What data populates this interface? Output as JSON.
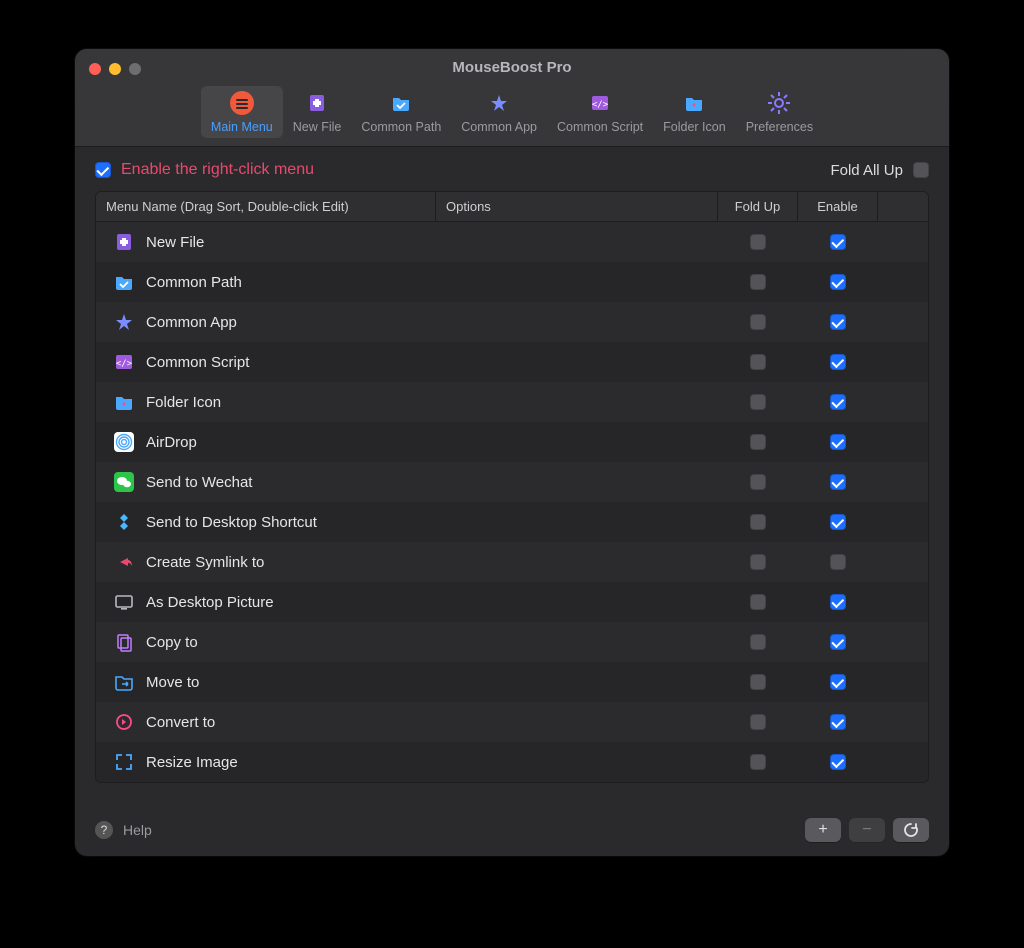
{
  "window_title": "MouseBoost Pro",
  "toolbar": [
    {
      "label": "Main Menu",
      "name": "tab-main-menu",
      "active": true
    },
    {
      "label": "New File",
      "name": "tab-new-file",
      "active": false
    },
    {
      "label": "Common Path",
      "name": "tab-common-path",
      "active": false
    },
    {
      "label": "Common App",
      "name": "tab-common-app",
      "active": false
    },
    {
      "label": "Common Script",
      "name": "tab-common-script",
      "active": false
    },
    {
      "label": "Folder Icon",
      "name": "tab-folder-icon",
      "active": false
    },
    {
      "label": "Preferences",
      "name": "tab-preferences",
      "active": false
    }
  ],
  "enable_label": "Enable the right-click menu",
  "enable_checked": true,
  "fold_all_label": "Fold All Up",
  "fold_all_checked": false,
  "columns": {
    "name": "Menu Name (Drag Sort, Double-click Edit)",
    "options": "Options",
    "fold": "Fold Up",
    "enable": "Enable"
  },
  "rows": [
    {
      "icon": "newfile",
      "icon_name": "new-file-icon",
      "label": "New File",
      "fold": false,
      "enable": true
    },
    {
      "icon": "path",
      "icon_name": "folder-path-icon",
      "label": "Common Path",
      "fold": false,
      "enable": true
    },
    {
      "icon": "app",
      "icon_name": "applications-icon",
      "label": "Common App",
      "fold": false,
      "enable": true
    },
    {
      "icon": "script",
      "icon_name": "script-icon",
      "label": "Common Script",
      "fold": false,
      "enable": true
    },
    {
      "icon": "foldericon",
      "icon_name": "folder-heart-icon",
      "label": "Folder Icon",
      "fold": false,
      "enable": true
    },
    {
      "icon": "airdrop",
      "icon_name": "airdrop-icon",
      "label": "AirDrop",
      "fold": false,
      "enable": true
    },
    {
      "icon": "wechat",
      "icon_name": "wechat-icon",
      "label": "Send to Wechat",
      "fold": false,
      "enable": true
    },
    {
      "icon": "shortcut",
      "icon_name": "desktop-shortcut-icon",
      "label": "Send to Desktop Shortcut",
      "fold": false,
      "enable": true
    },
    {
      "icon": "symlink",
      "icon_name": "symlink-icon",
      "label": "Create Symlink to",
      "fold": false,
      "enable": false
    },
    {
      "icon": "desktop",
      "icon_name": "desktop-picture-icon",
      "label": "As Desktop Picture",
      "fold": false,
      "enable": true
    },
    {
      "icon": "copy",
      "icon_name": "copy-icon",
      "label": "Copy to",
      "fold": false,
      "enable": true
    },
    {
      "icon": "move",
      "icon_name": "move-icon",
      "label": "Move to",
      "fold": false,
      "enable": true
    },
    {
      "icon": "convert",
      "icon_name": "convert-icon",
      "label": "Convert to",
      "fold": false,
      "enable": true
    },
    {
      "icon": "resize",
      "icon_name": "resize-icon",
      "label": "Resize Image",
      "fold": false,
      "enable": true
    }
  ],
  "footer": {
    "help": "Help",
    "add": "+",
    "remove": "−",
    "reload": "↻"
  },
  "icon_svgs": {
    "mainmenu": "<svg width='26' height='26'><circle cx='13' cy='13' r='12' fill='#f05a3a'/><rect x='7' y='9' width='12' height='2' rx='1' fill='#2a2a2c'/><rect x='7' y='13' width='12' height='2' rx='1' fill='#2a2a2c'/><rect x='7' y='17' width='12' height='2' rx='1' fill='#2a2a2c'/></svg>",
    "newfile": "<svg width='20' height='20'><rect x='3' y='2' width='14' height='16' rx='2' fill='#8a5ce0'/><rect x='8' y='6' width='4' height='8' fill='#fff'/><rect x='6' y='8' width='8' height='4' fill='#fff'/></svg>",
    "path": "<svg width='20' height='20'><path d='M2 5h6l2 2h8v9a2 2 0 0 1-2 2H4a2 2 0 0 1-2-2z' fill='#4aa8ff'/><path d='M6 12l3 3 5-5' stroke='#fff' stroke-width='1.8' fill='none'/></svg>",
    "app": "<svg width='20' height='20'><path d='M10 2l2 6h6l-5 4 2 6-5-4-5 4 2-6-5-4h6z' fill='#7a8cff'/></svg>",
    "script": "<svg width='20' height='20'><rect x='2' y='3' width='16' height='14' rx='2' fill='#a05ae0'/><text x='10' y='14' font-size='9' text-anchor='middle' fill='#fff' font-family='monospace'>&lt;/&gt;</text></svg>",
    "foldericon": "<svg width='20' height='20'><path d='M2 5h6l2 2h8v9a2 2 0 0 1-2 2H4a2 2 0 0 1-2-2z' fill='#4aa8ff'/><path d='M10 10l1.2 1 .3 1.5-1.5 1.5-1.5-1.5.3-1.5z' fill='#ff4a8a'/></svg>",
    "airdrop": "<svg width='20' height='20'><rect width='20' height='20' rx='4' fill='#fff'/><circle cx='10' cy='10' r='2.5' fill='none' stroke='#4aa8ff' stroke-width='1.4'/><circle cx='10' cy='10' r='5' fill='none' stroke='#4aa8ff' stroke-width='1.4'/><circle cx='10' cy='10' r='7.5' fill='none' stroke='#4aa8ff' stroke-width='1.4'/></svg>",
    "wechat": "<svg width='20' height='20'><rect width='20' height='20' rx='4' fill='#2cc54a'/><ellipse cx='8' cy='9' rx='5' ry='4' fill='#fff'/><ellipse cx='13' cy='12' rx='4' ry='3.2' fill='#fff'/></svg>",
    "shortcut": "<svg width='20' height='20'><path d='M10 2l4 4-4 4-4-4z M10 10l4 4-4 4-4-4z' fill='#4ab8ff'/></svg>",
    "symlink": "<svg width='20' height='20'><path d='M14 6l-8 4 8 4v-3c2 0 3 1 4 3 0-4-2-6-4-6z' fill='#e84a6f'/></svg>",
    "desktop": "<svg width='20' height='20'><rect x='2' y='4' width='16' height='11' rx='1.5' fill='none' stroke='#b8b8c0' stroke-width='1.6'/><rect x='7' y='16' width='6' height='1.6' fill='#b8b8c0'/></svg>",
    "copy": "<svg width='20' height='20'><rect x='4' y='3' width='10' height='13' rx='1' fill='none' stroke='#c080ff' stroke-width='1.5'/><rect x='7' y='6' width='10' height='13' rx='1' fill='none' stroke='#c080ff' stroke-width='1.5'/></svg>",
    "move": "<svg width='20' height='20'><path d='M2 5h6l2 2h8v9a2 2 0 0 1-2 2H4a2 2 0 0 1-2-2z' fill='none' stroke='#4aa8ff' stroke-width='1.6'/><path d='M8 12h6m0 0l-2-2m2 2l-2 2' stroke='#4aa8ff' stroke-width='1.6' fill='none'/></svg>",
    "convert": "<svg width='20' height='20'><circle cx='10' cy='10' r='7' fill='none' stroke='#ff4a8a' stroke-width='1.8'/><path d='M8 7l4 3-4 3z' fill='#ff4a8a'/></svg>",
    "resize": "<svg width='20' height='20'><path d='M3 8V3h5 M17 12v5h-5 M3 12v5h5 M17 8V3h-5' stroke='#4aa8ff' stroke-width='1.8' fill='none'/></svg>",
    "gear": "<svg width='26' height='26'><circle cx='13' cy='13' r='4' fill='none' stroke='#8a7aff' stroke-width='2'/><g stroke='#8a7aff' stroke-width='2'><line x1='13' y1='2' x2='13' y2='6'/><line x1='13' y1='20' x2='13' y2='24'/><line x1='2' y1='13' x2='6' y2='13'/><line x1='20' y1='13' x2='24' y2='13'/><line x1='5' y1='5' x2='8' y2='8'/><line x1='18' y1='18' x2='21' y2='21'/><line x1='5' y1='21' x2='8' y2='18'/><line x1='18' y1='8' x2='21' y2='5'/></g></svg>"
  },
  "toolbar_icons": [
    "mainmenu",
    "newfile",
    "path",
    "app",
    "script",
    "foldericon",
    "gear"
  ]
}
